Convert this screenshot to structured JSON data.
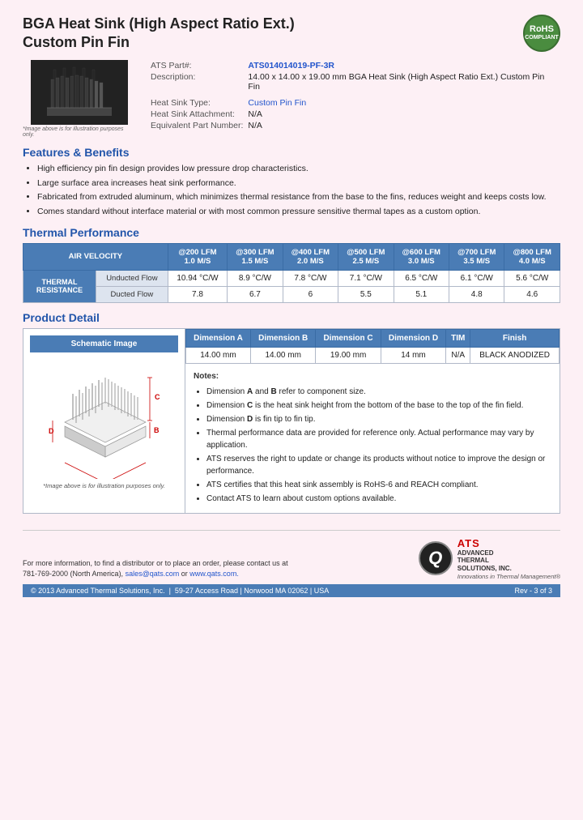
{
  "header": {
    "title_line1": "BGA Heat Sink (High Aspect Ratio Ext.)",
    "title_line2": "Custom Pin Fin",
    "rohs": {
      "line1": "RoHS",
      "line2": "COMPLIANT"
    }
  },
  "part_info": {
    "ats_part_label": "ATS Part#:",
    "ats_part_value": "ATS014014019-PF-3R",
    "description_label": "Description:",
    "description_value": "14.00 x 14.00 x 19.00 mm  BGA Heat Sink (High Aspect Ratio Ext.) Custom Pin Fin",
    "heat_sink_type_label": "Heat Sink Type:",
    "heat_sink_type_value": "Custom Pin Fin",
    "attachment_label": "Heat Sink Attachment:",
    "attachment_value": "N/A",
    "equivalent_label": "Equivalent Part Number:",
    "equivalent_value": "N/A",
    "image_caption": "*Image above is for illustration purposes only."
  },
  "features": {
    "heading": "Features & Benefits",
    "items": [
      "High efficiency pin fin design provides low pressure drop characteristics.",
      "Large surface area increases heat sink performance.",
      "Fabricated from extruded aluminum, which minimizes thermal resistance from the base to the fins, reduces weight and keeps costs low.",
      "Comes standard without interface material or with most common pressure sensitive thermal tapes as a custom option."
    ]
  },
  "thermal_performance": {
    "heading": "Thermal Performance",
    "col_header_row1": "AIR VELOCITY",
    "columns": [
      {
        "top": "@200 LFM",
        "bottom": "1.0 M/S"
      },
      {
        "top": "@300 LFM",
        "bottom": "1.5 M/S"
      },
      {
        "top": "@400 LFM",
        "bottom": "2.0 M/S"
      },
      {
        "top": "@500 LFM",
        "bottom": "2.5 M/S"
      },
      {
        "top": "@600 LFM",
        "bottom": "3.0 M/S"
      },
      {
        "top": "@700 LFM",
        "bottom": "3.5 M/S"
      },
      {
        "top": "@800 LFM",
        "bottom": "4.0 M/S"
      }
    ],
    "row_label": "THERMAL RESISTANCE",
    "rows": [
      {
        "label": "Unducted Flow",
        "values": [
          "10.94 °C/W",
          "8.9 °C/W",
          "7.8 °C/W",
          "7.1 °C/W",
          "6.5 °C/W",
          "6.1 °C/W",
          "5.6 °C/W"
        ]
      },
      {
        "label": "Ducted Flow",
        "values": [
          "7.8",
          "6.7",
          "6",
          "5.5",
          "5.1",
          "4.8",
          "4.6"
        ]
      }
    ]
  },
  "product_detail": {
    "heading": "Product Detail",
    "schematic_header": "Schematic Image",
    "schematic_caption": "*Image above is for illustration purposes only.",
    "columns": [
      "Dimension A",
      "Dimension B",
      "Dimension C",
      "Dimension D",
      "TIM",
      "Finish"
    ],
    "row": [
      "14.00 mm",
      "14.00 mm",
      "19.00 mm",
      "14 mm",
      "N/A",
      "BLACK ANODIZED"
    ],
    "notes_title": "Notes:",
    "notes": [
      "Dimension A and B refer to component size.",
      "Dimension C is the heat sink height from the bottom of the base to the top of the fin field.",
      "Dimension D is fin tip to fin tip.",
      "Thermal performance data are provided for reference only. Actual performance may vary by application.",
      "ATS reserves the right to update or change its products without notice to improve the design or performance.",
      "ATS certifies that this heat sink assembly is RoHS-6 and REACH compliant.",
      "Contact ATS to learn about custom options available."
    ]
  },
  "footer": {
    "contact_text": "For more information, to find a distributor or to place an order, please contact us at",
    "phone": "781-769-2000 (North America),",
    "email": "sales@qats.com",
    "or": "or",
    "website": "www.qats.com.",
    "copyright": "© 2013 Advanced Thermal Solutions, Inc.",
    "address": "59-27 Access Road  |  Norwood MA  02062  |  USA",
    "page_info": "Rev - 3 of 3",
    "logo_q": "Q",
    "logo_ats": "ATS",
    "logo_sub1": "ADVANCED",
    "logo_sub2": "THERMAL",
    "logo_sub3": "SOLUTIONS, INC.",
    "logo_tagline": "Innovations in Thermal Management®"
  }
}
